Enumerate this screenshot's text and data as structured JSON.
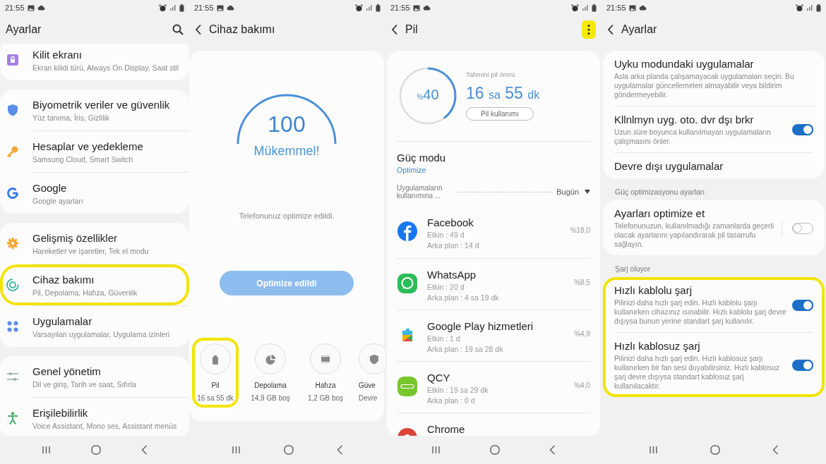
{
  "screens": [
    {
      "kind": "settings",
      "status_bar": {
        "time": "21:55"
      },
      "header": {
        "title": "Ayarlar",
        "search": true
      },
      "groups": [
        [
          {
            "kind": "lock",
            "title": "Kilit ekranı",
            "subtitle": "Ekran kilidi türü, Always On Display, Saat stil",
            "highlighted": false
          }
        ],
        [
          {
            "kind": "shield",
            "title": "Biyometrik veriler ve güvenlik",
            "subtitle": "Yüz tanıma, İris, Gizlilik",
            "highlighted": false
          },
          {
            "kind": "key",
            "title": "Hesaplar ve yedekleme",
            "subtitle": "Samsung Cloud, Smart Switch",
            "highlighted": false
          },
          {
            "kind": "google",
            "title": "Google",
            "subtitle": "Google ayarları",
            "highlighted": false
          }
        ],
        [
          {
            "kind": "gear",
            "title": "Gelişmiş özellikler",
            "subtitle": "Hareketler ve işaretler, Tek el modu",
            "highlighted": false
          },
          {
            "kind": "care",
            "title": "Cihaz bakımı",
            "subtitle": "Pil, Depolama, Hafıza, Güvenlik",
            "highlighted": true
          },
          {
            "kind": "apps",
            "title": "Uygulamalar",
            "subtitle": "Varsayılan uygulamalar, Uygulama izinleri",
            "highlighted": false
          }
        ],
        [
          {
            "kind": "sliders",
            "title": "Genel yönetim",
            "subtitle": "Dil ve giriş, Tarih ve saat, Sıfırla",
            "highlighted": false
          },
          {
            "kind": "person",
            "title": "Erişilebilirlik",
            "subtitle": "Voice Assistant, Mono ses, Assistant menüs",
            "highlighted": false
          }
        ]
      ]
    },
    {
      "kind": "care",
      "status_bar": {
        "time": "21:55"
      },
      "header": {
        "title": "Cihaz bakımı",
        "back": true
      },
      "score": "100",
      "rating": "Mükemmel!",
      "message": "Telefonunuz optimize edildi.",
      "button": {
        "label": "Optimize edildi",
        "disabled": true
      },
      "tiles": [
        {
          "kind": "battery",
          "label": "Pil",
          "value": "16 sa 55 dk",
          "highlighted": true
        },
        {
          "kind": "storage",
          "label": "Depolama",
          "value": "14,9 GB boş",
          "highlighted": false
        },
        {
          "kind": "memory",
          "label": "Hafıza",
          "value": "1,2 GB boş",
          "highlighted": false
        },
        {
          "kind": "security",
          "label": "Güve",
          "value": "Devre",
          "highlighted": false
        }
      ]
    },
    {
      "kind": "battery",
      "status_bar": {
        "time": "21:55"
      },
      "header": {
        "title": "Pil",
        "back": true,
        "menu": {
          "highlighted": true
        }
      },
      "battery": {
        "level": 0.4,
        "percent_sign": "%",
        "percent": "40",
        "estimate_label": "Tahmini pil ömrü",
        "hours": "16",
        "hours_unit": "sa",
        "minutes": "55",
        "minutes_unit": "dk",
        "usage_button": "Pil kullanımı"
      },
      "power_mode": {
        "title": "Güç modu",
        "value": "Optimize"
      },
      "usage": {
        "label": "Uygulamaların kullanımına ...",
        "period": "Bugün"
      },
      "apps": [
        {
          "kind": "facebook",
          "name": "Facebook",
          "active": "Etkin : 49 d",
          "background": "Arka plan : 14 d",
          "share": "%18,0"
        },
        {
          "kind": "whatsapp",
          "name": "WhatsApp",
          "active": "Etkin : 20 d",
          "background": "Arka plan : 4 sa 19 dk",
          "share": "%8,5"
        },
        {
          "kind": "play",
          "name": "Google Play hizmetleri",
          "active": "Etkin : 1 d",
          "background": "Arka plan : 19 sa 28 dk",
          "share": "%4,9"
        },
        {
          "kind": "qcy",
          "name": "QCY",
          "active": "Etkin : 19 sa 29 dk",
          "background": "Arka plan : 0 d",
          "share": "%4,0"
        },
        {
          "kind": "chrome",
          "name": "Chrome"
        }
      ]
    },
    {
      "kind": "battery_settings",
      "status_bar": {
        "time": "21:55"
      },
      "header": {
        "title": "Ayarlar",
        "back": true
      },
      "sections": [
        {
          "highlighted": false,
          "items": [
            {
              "title": "Uyku modundaki uygulamalar",
              "description": "Asla arka planda çalışamayacak uygulamaları seçin. Bu uygulamalar güncellemeleri almayabilir veya bildirim göndermeyebilir."
            },
            {
              "title": "Kllnlmyn uyg. oto. dvr dşı brkr",
              "description": "Uzun süre boyunca kullanılmayan uygulamaların çalışmasını önler.",
              "on": true
            },
            {
              "title": "Devre dışı uygulamalar"
            }
          ]
        },
        {
          "label": "Güç optimizasyonu ayarları",
          "highlighted": false,
          "items": [
            {
              "title": "Ayarları optimize et",
              "description": "Telefonunuzun, kullanılmadığı zamanlarda geçerli olacak ayarlarını yapılandırarak pil tasarrufu sağlayın.",
              "on": false
            }
          ]
        },
        {
          "label": "Şarj oluyor",
          "highlighted": true,
          "items": [
            {
              "title": "Hızlı kablolu şarj",
              "description": "Pilinizi daha hızlı şarj edin. Hızlı kablolu şarjı kullanırken cihazınız ısınabilir. Hızlı kablolu şarj devre dışıysa bunun yerine standart şarj kullanılır.",
              "on": true
            },
            {
              "title": "Hızlı kablosuz şarj",
              "description": "Pilinizi daha hızlı şarj edin. Hızlı kablosuz şarjı kullanırken bir fan sesi duyabilirsiniz. Hızlı kablosuz şarj devre dışıysa standart kablosuz şarj kullanılacaktır.",
              "on": true
            }
          ]
        }
      ]
    }
  ]
}
